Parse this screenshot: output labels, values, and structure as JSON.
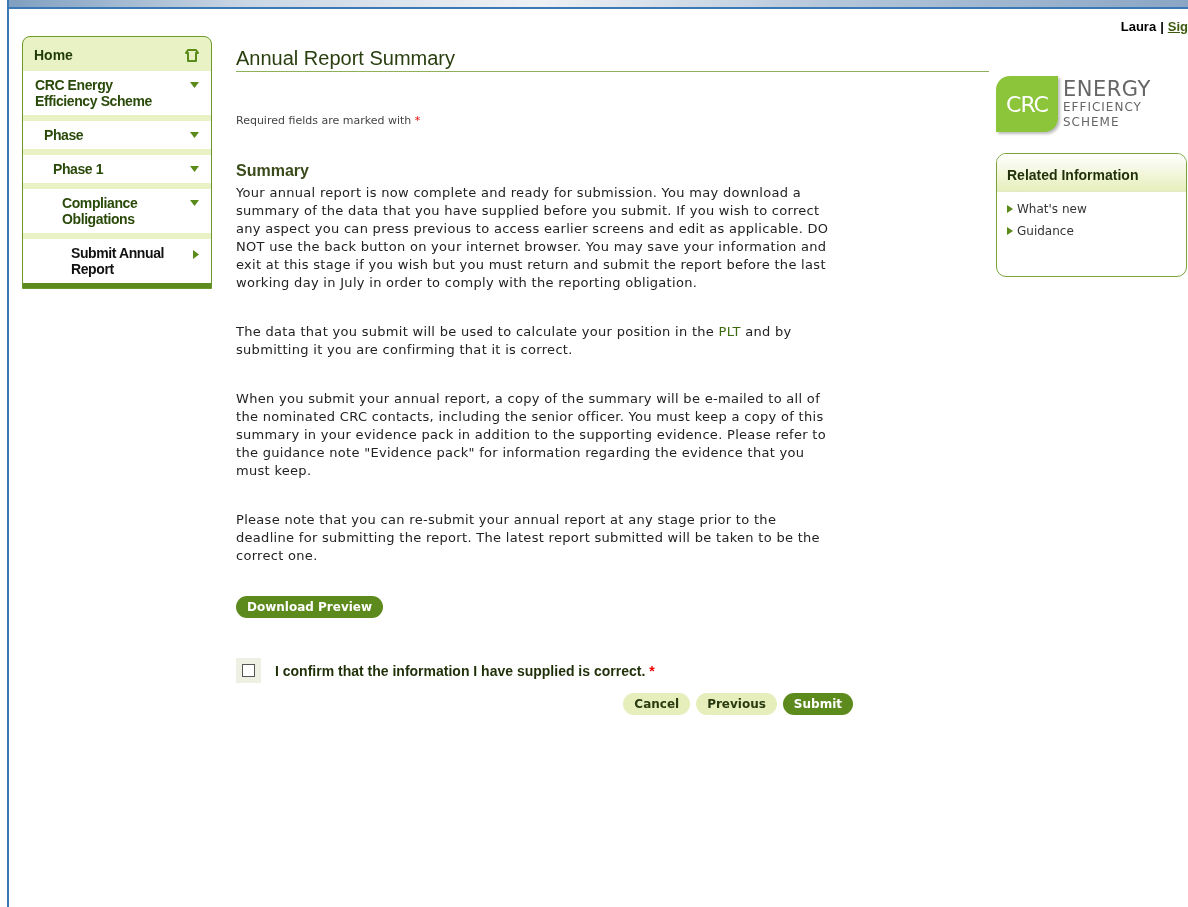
{
  "user": {
    "name": "Laura",
    "separator": "|",
    "link": "Sig"
  },
  "nav": {
    "label": "Home",
    "children": [
      {
        "label": "CRC Energy Efficiency Scheme",
        "expanded": true,
        "selected": false,
        "children": [
          {
            "label": "Phase",
            "expanded": true,
            "selected": false,
            "children": [
              {
                "label": "Phase 1",
                "expanded": true,
                "selected": false,
                "children": [
                  {
                    "label": "Compliance Obligations",
                    "expanded": true,
                    "selected": false,
                    "children": [
                      {
                        "label": "Submit Annual Report",
                        "expanded": false,
                        "selected": true
                      }
                    ]
                  }
                ]
              }
            ]
          }
        ]
      }
    ]
  },
  "page": {
    "title": "Annual Report Summary",
    "required_note": "Required fields are marked with",
    "required_mark": "*",
    "section_title": "Summary",
    "paragraphs": [
      "Your annual report is now complete and ready for submission. You may download a summary of the data that you have supplied before you submit. If you wish to correct any aspect you can press previous to access earlier screens and edit as applicable. DO NOT use the back button on your internet browser. You may save your information and exit at this stage if you wish but you must return and submit the report before the last working day in July in order to comply with the reporting obligation.",
      "The data that you submit will be used to calculate your position in the **PLT** and by submitting it you are confirming that it is correct.",
      "When you submit your annual report, a copy of the summary will be e-mailed to all of the nominated CRC contacts, including the senior officer. You must keep a copy of this summary in your evidence pack in addition to the supporting evidence. Please refer to the guidance note \"Evidence pack\" for information regarding the evidence that you must keep.",
      "Please note that you can re-submit your annual report at any stage prior to the deadline for submitting the report. The latest report submitted will be taken to be the correct one."
    ],
    "download_button": "Download Preview",
    "confirm": {
      "label": "I confirm that the information I have supplied is correct.",
      "mark": "*",
      "checked": false
    },
    "buttons": [
      {
        "label": "Cancel",
        "kind": "secondary"
      },
      {
        "label": "Previous",
        "kind": "secondary"
      },
      {
        "label": "Submit",
        "kind": "primary"
      }
    ]
  },
  "logo": {
    "badge": "CRC",
    "line1": "ENERGY",
    "line2": "EFFICIENCY",
    "line3": "SCHEME"
  },
  "related": {
    "title": "Related Information",
    "links": [
      "What's new",
      "Guidance"
    ]
  }
}
